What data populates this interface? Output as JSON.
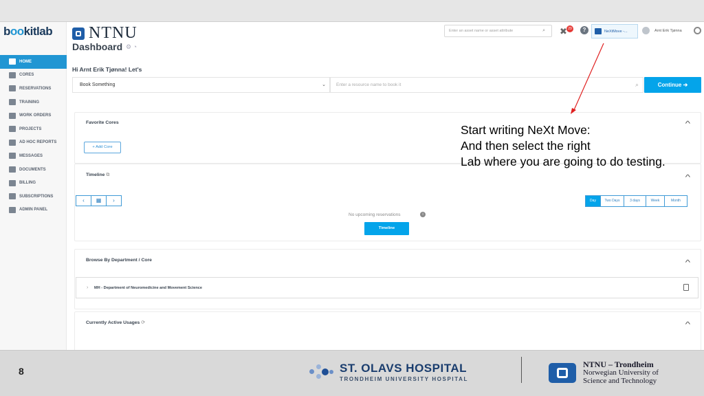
{
  "app": {
    "logo_text": "bookitlab",
    "institution": "NTNU",
    "page_title": "Dashboard",
    "greeting": "Hi Arnt Erik Tjønna! Let's"
  },
  "topbar": {
    "search_placeholder": "Enter an asset name or asset attribute",
    "notification_count": "29",
    "lab_selector_label": "NeXtMove -...",
    "user_name": "Arnt Erik Tjønna"
  },
  "sidebar": {
    "items": [
      {
        "label": "HOME",
        "icon": "home-icon",
        "active": true
      },
      {
        "label": "CORES",
        "icon": "stack-icon",
        "active": false
      },
      {
        "label": "RESERVATIONS",
        "icon": "calendar-icon",
        "active": false
      },
      {
        "label": "TRAINING",
        "icon": "dumbbell-icon",
        "active": false
      },
      {
        "label": "WORK ORDERS",
        "icon": "clipboard-icon",
        "active": false
      },
      {
        "label": "PROJECTS",
        "icon": "folder-icon",
        "active": false
      },
      {
        "label": "AD HOC REPORTS",
        "icon": "pie-chart-icon",
        "active": false
      },
      {
        "label": "MESSAGES",
        "icon": "megaphone-icon",
        "active": false
      },
      {
        "label": "DOCUMENTS",
        "icon": "documents-icon",
        "active": false
      },
      {
        "label": "BILLING",
        "icon": "invoice-icon",
        "active": false
      },
      {
        "label": "SUBSCRIPTIONS",
        "icon": "subscriptions-icon",
        "active": false
      },
      {
        "label": "ADMIN PANEL",
        "icon": "gear-icon",
        "active": false
      }
    ]
  },
  "booking": {
    "select_value": "Book Something",
    "resource_placeholder": "Enter a resource name to book it",
    "continue_label": "Continue"
  },
  "favorites": {
    "title": "Favorite Cores",
    "add_label": "+ Add Core"
  },
  "timeline": {
    "title": "Timeline",
    "empty_message": "No upcoming reservations",
    "button_label": "Timeline",
    "ranges": [
      "Day",
      "Two Days",
      "3 days",
      "Week",
      "Month"
    ],
    "active_range": "Day"
  },
  "browse": {
    "title": "Browse By Department / Core",
    "departments": [
      "MH - Department of Neuromedicine and Movement Science"
    ]
  },
  "active_usages": {
    "title": "Currently Active Usages"
  },
  "annotation": {
    "line1": "Start writing NeXt Move:",
    "line2": "And then select the right",
    "line3": "Lab where you are going to do testing."
  },
  "footer": {
    "page_number": "8",
    "hospital_name": "ST. OLAVS HOSPITAL",
    "hospital_sub": "TRONDHEIM UNIVERSITY HOSPITAL",
    "ntnu_line1": "NTNU – Trondheim",
    "ntnu_line2": "Norwegian University of",
    "ntnu_line3": "Science and Technology"
  },
  "colors": {
    "accent": "#04a4ea",
    "brand_blue": "#1f5ea8",
    "annotation_arrow": "#e02020"
  }
}
